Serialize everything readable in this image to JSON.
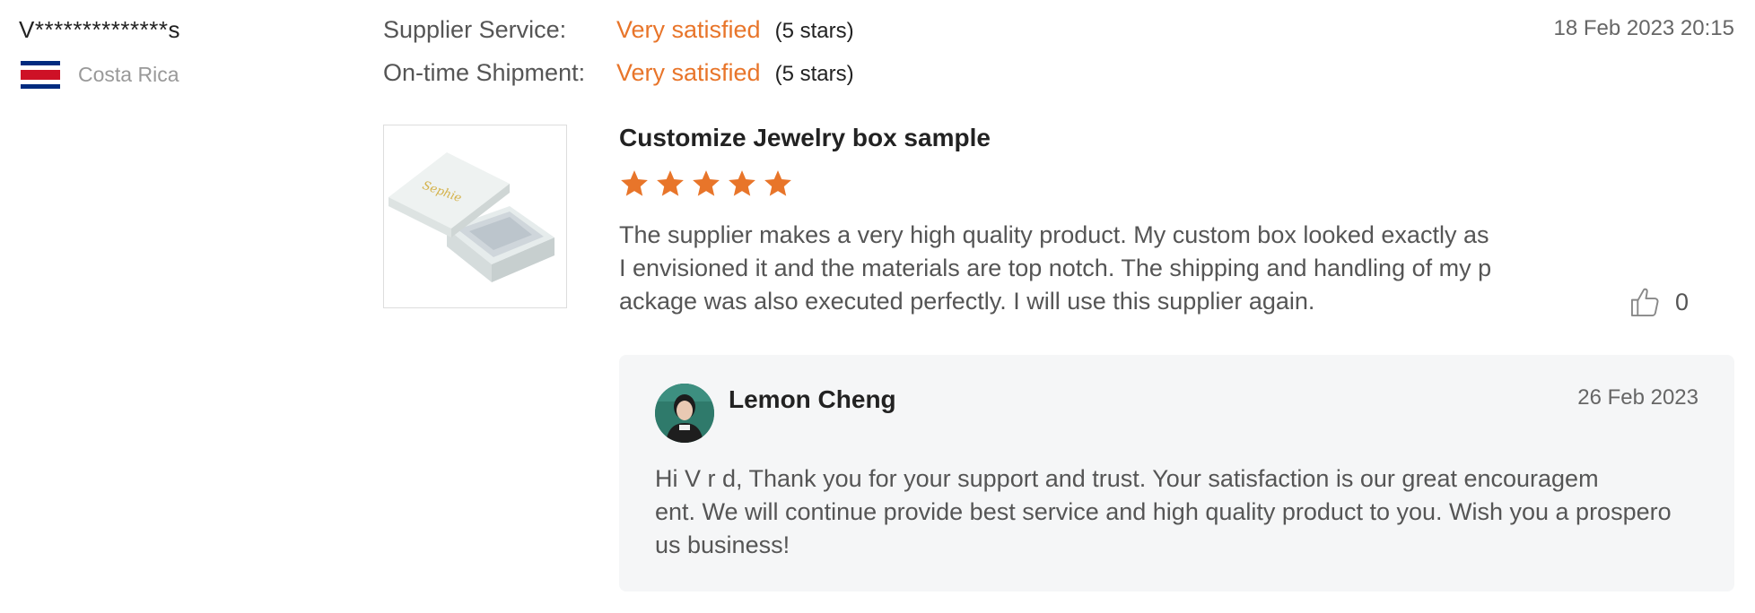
{
  "reviewer": {
    "name": "V**************s",
    "country": "Costa Rica"
  },
  "ratings": [
    {
      "label": "Supplier Service:",
      "value": "Very satisfied",
      "stars_text": "(5 stars)"
    },
    {
      "label": "On-time Shipment:",
      "value": "Very satisfied",
      "stars_text": "(5 stars)"
    }
  ],
  "review": {
    "date": "18 Feb 2023 20:15",
    "product_title": "Customize Jewelry box sample",
    "star_rating": 5,
    "text": "The supplier makes a very high quality product. My custom box looked exactly as\nI envisioned it and the materials are top notch. The shipping and handling of my p\nackage was also executed perfectly. I will use this supplier again.",
    "likes": "0",
    "product_image_text": "Sephie"
  },
  "reply": {
    "name": "Lemon Cheng",
    "date": "26 Feb 2023",
    "text": "Hi V  r  d,   Thank you for your support and trust. Your satisfaction is our great encouragem\nent. We will continue provide best service and high quality product to you. Wish you a prospero\nus business!"
  },
  "colors": {
    "accent": "#e8752a",
    "reply_bg": "#f5f6f7",
    "flag_blue": "#002b7f",
    "flag_red": "#ce1126"
  },
  "icons": {
    "like": "thumbs-up-icon",
    "star": "star-icon"
  }
}
